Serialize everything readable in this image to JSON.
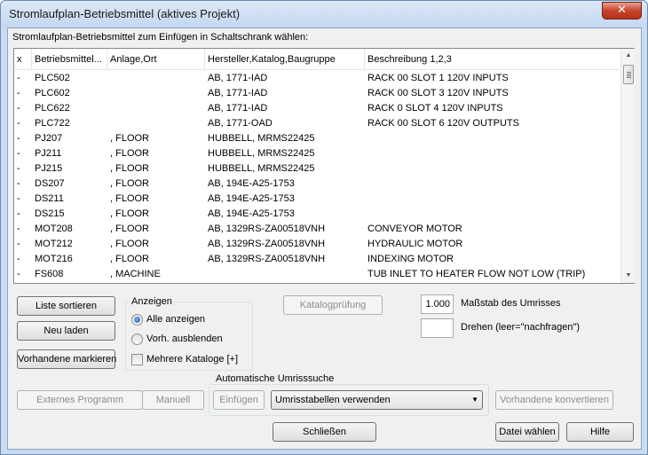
{
  "window": {
    "title": "Stromlaufplan-Betriebsmittel (aktives Projekt)",
    "close_glyph": "✕"
  },
  "instruction": "Stromlaufplan-Betriebsmittel zum Einfügen in Schaltschrank wählen:",
  "table": {
    "columns": [
      "x",
      "Betriebsmittel...",
      "Anlage,Ort",
      "Hersteller,Katalog,Baugruppe",
      "Beschreibung 1,2,3"
    ],
    "rows": [
      [
        "-",
        "PLC502",
        "",
        "AB, 1771-IAD",
        "RACK 00 SLOT 1 120V INPUTS"
      ],
      [
        "-",
        "PLC602",
        "",
        "AB, 1771-IAD",
        "RACK 00 SLOT 3 120V INPUTS"
      ],
      [
        "-",
        "PLC622",
        "",
        "AB, 1771-IAD",
        "RACK 0 SLOT 4 120V INPUTS"
      ],
      [
        "-",
        "PLC722",
        "",
        "AB, 1771-OAD",
        "RACK 00 SLOT 6 120V OUTPUTS"
      ],
      [
        "-",
        "PJ207",
        ", FLOOR",
        "HUBBELL, MRMS22425",
        ""
      ],
      [
        "-",
        "PJ211",
        ", FLOOR",
        "HUBBELL, MRMS22425",
        ""
      ],
      [
        "-",
        "PJ215",
        ", FLOOR",
        "HUBBELL, MRMS22425",
        ""
      ],
      [
        "-",
        "DS207",
        ", FLOOR",
        "AB, 194E-A25-1753",
        ""
      ],
      [
        "-",
        "DS211",
        ", FLOOR",
        "AB, 194E-A25-1753",
        ""
      ],
      [
        "-",
        "DS215",
        ", FLOOR",
        "AB, 194E-A25-1753",
        ""
      ],
      [
        "-",
        "MOT208",
        ", FLOOR",
        "AB, 1329RS-ZA00518VNH",
        "CONVEYOR MOTOR"
      ],
      [
        "-",
        "MOT212",
        ", FLOOR",
        "AB, 1329RS-ZA00518VNH",
        "HYDRAULIC MOTOR"
      ],
      [
        "-",
        "MOT216",
        ", FLOOR",
        "AB, 1329RS-ZA00518VNH",
        "INDEXING MOTOR"
      ],
      [
        "-",
        "FS608",
        ", MACHINE",
        "",
        "TUB INLET TO HEATER FLOW NOT LOW (TRIP)"
      ]
    ],
    "scroll_up_glyph": "▲",
    "scroll_down_glyph": "▼"
  },
  "buttons": {
    "sort": "Liste sortieren",
    "reload": "Neu laden",
    "mark_existing": "Vorhandene markieren",
    "catalog_check": "Katalogprüfung",
    "external_program": "Externes Programm",
    "manual": "Manuell",
    "insert": "Einfügen",
    "convert_existing": "Vorhandene konvertieren",
    "close": "Schließen",
    "choose_file": "Datei wählen",
    "help": "Hilfe"
  },
  "display_group": {
    "title": "Anzeigen",
    "show_all": "Alle anzeigen",
    "hide_existing": "Vorh. ausblenden",
    "multiple_catalogs": "Mehrere Kataloge [+]",
    "selected": "show_all",
    "multiple_catalogs_checked": false
  },
  "scale": {
    "value": "1.000",
    "label": "Maßstab des Umrisses"
  },
  "rotate": {
    "value": "",
    "label": "Drehen (leer=\"nachfragen\")"
  },
  "auto_outline": {
    "title": "Automatische Umrisssuche",
    "dropdown_value": "Umrisstabellen verwenden",
    "dropdown_arrow": "▼"
  }
}
